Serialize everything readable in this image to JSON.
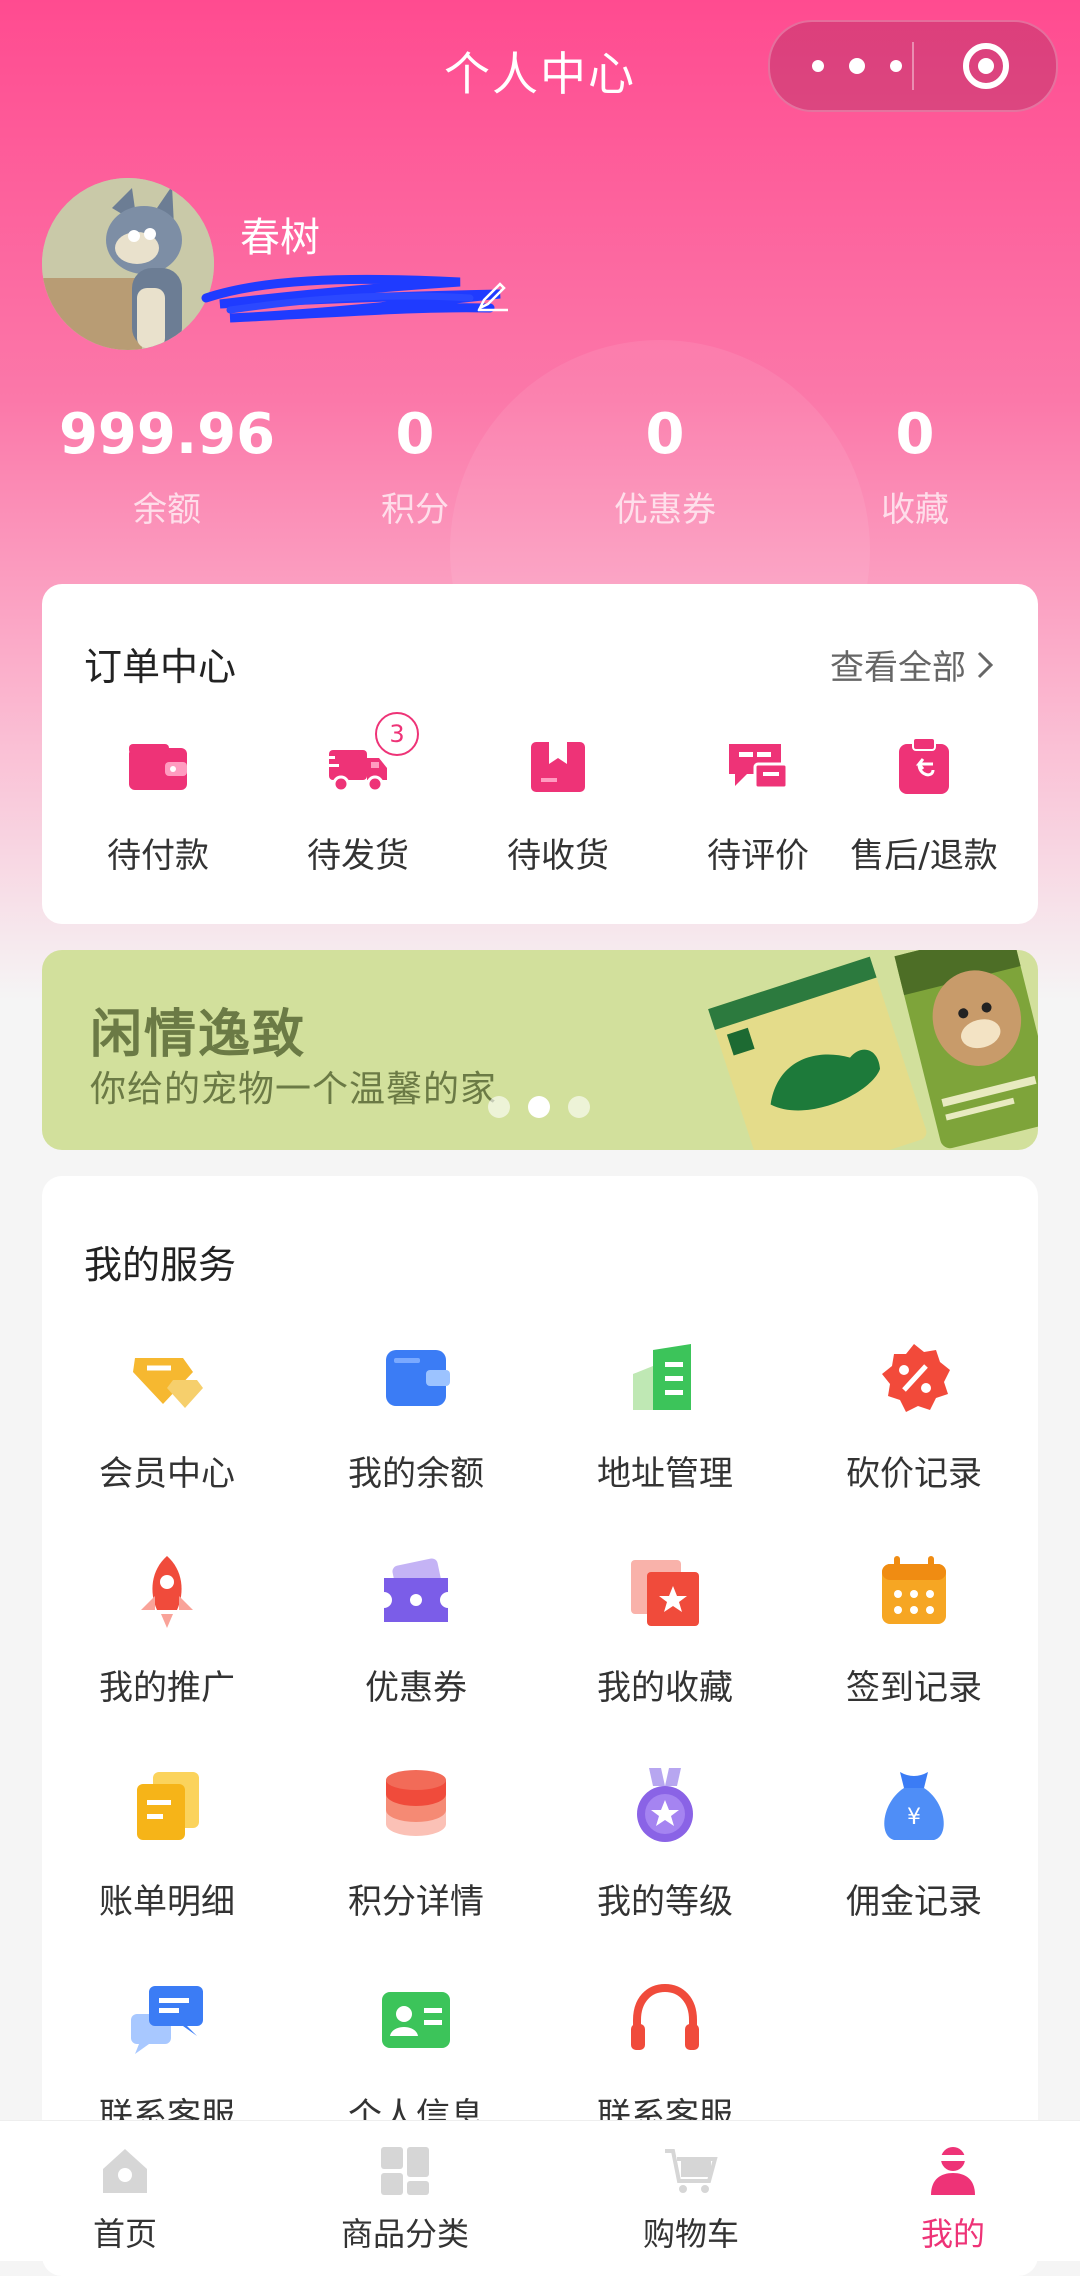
{
  "nav": {
    "title": "个人中心"
  },
  "profile": {
    "username": "春树"
  },
  "stats": [
    {
      "value": "999.96",
      "label": "余额"
    },
    {
      "value": "0",
      "label": "积分"
    },
    {
      "value": "0",
      "label": "优惠券"
    },
    {
      "value": "0",
      "label": "收藏"
    }
  ],
  "orders": {
    "title": "订单中心",
    "view_all": "查看全部",
    "items": [
      {
        "label": "待付款",
        "icon": "wallet-icon"
      },
      {
        "label": "待发货",
        "icon": "truck-icon",
        "badge": "3"
      },
      {
        "label": "待收货",
        "icon": "package-icon"
      },
      {
        "label": "待评价",
        "icon": "comment-icon"
      },
      {
        "label": "售后/退款",
        "icon": "refund-icon"
      }
    ]
  },
  "banner": {
    "title": "闲情逸致",
    "subtitle": "你给的宠物一个温馨的家",
    "dots": 3,
    "active_dot": 1
  },
  "services": {
    "title": "我的服务",
    "items": [
      {
        "label": "会员中心",
        "icon": "member-icon"
      },
      {
        "label": "我的余额",
        "icon": "balance-icon"
      },
      {
        "label": "地址管理",
        "icon": "address-icon"
      },
      {
        "label": "砍价记录",
        "icon": "bargain-icon"
      },
      {
        "label": "我的推广",
        "icon": "rocket-icon"
      },
      {
        "label": "优惠券",
        "icon": "coupon-icon"
      },
      {
        "label": "我的收藏",
        "icon": "favorite-icon"
      },
      {
        "label": "签到记录",
        "icon": "calendar-icon"
      },
      {
        "label": "账单明细",
        "icon": "bill-icon"
      },
      {
        "label": "积分详情",
        "icon": "points-icon"
      },
      {
        "label": "我的等级",
        "icon": "medal-icon"
      },
      {
        "label": "佣金记录",
        "icon": "money-bag-icon"
      },
      {
        "label": "联系客服",
        "icon": "chat-icon"
      },
      {
        "label": "个人信息",
        "icon": "id-card-icon"
      },
      {
        "label": "联系客服",
        "icon": "headset-icon"
      }
    ]
  },
  "tabbar": [
    {
      "label": "首页",
      "icon": "home-icon",
      "active": false
    },
    {
      "label": "商品分类",
      "icon": "category-icon",
      "active": false
    },
    {
      "label": "购物车",
      "icon": "cart-icon",
      "active": false
    },
    {
      "label": "我的",
      "icon": "user-icon",
      "active": true
    }
  ],
  "colors": {
    "primary": "#ee3377",
    "header_top": "#ff4b90",
    "banner_bg": "#d2e09c"
  }
}
